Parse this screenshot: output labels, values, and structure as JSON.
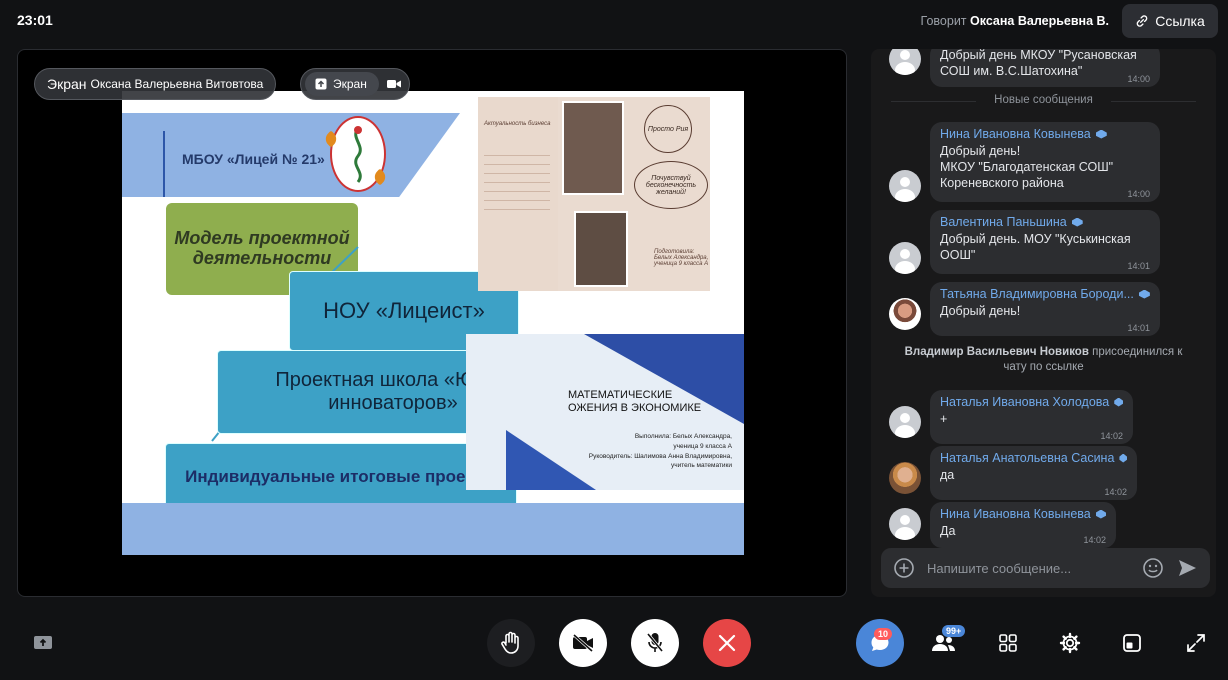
{
  "topbar": {
    "clock": "23:01",
    "speaking_prefix": "Говорит",
    "speaking_name": "Оксана Валерьевна В.",
    "link_label": "Ссылка"
  },
  "stage": {
    "pill_prefix": "Экран",
    "pill_name": "Оксана Валерьевна Витовтова",
    "screen_chip": "Экран"
  },
  "slide": {
    "school": "МБОУ «Лицей № 21»",
    "green_title": "Модель проектной деятельности",
    "box1": "НОУ «Лицеист»",
    "box2": "Проектная школа «Юных инноваторов»",
    "box3": "Индивидуальные итоговые проекты",
    "poster": {
      "header": "Актуальность бизнеса",
      "logo": "Просто Рия",
      "oval": "Почувствуй бесконечность желаний!",
      "author": "Подготовила: Белых Александра, ученица 9 класса А"
    },
    "cover": {
      "title_line1": "МАТЕМАТИЧЕСКИЕ",
      "title_line2": "ОЖЕНИЯ В ЭКОНОМИКЕ",
      "author_line1": "Выполнила: Белых Александра,",
      "author_line2": "ученица 9 класса А",
      "author_line3": "Руководитель: Шалимова Анна Владимировна,",
      "author_line4": "учитель математики"
    }
  },
  "chat": {
    "divider": "Новые сообщения",
    "system_name": "Владимир Васильевич Новиков",
    "system_text": " присоединился к чату по ссылке",
    "input_placeholder": "Напишите сообщение...",
    "messages": [
      {
        "name": "",
        "text": "Добрый день МКОУ \"Русановская\nСОШ им. В.С.Шатохина\"",
        "time": "14:00"
      },
      {
        "name": "Нина Ивановна Ковынева",
        "text": "Добрый день!\nМКОУ \"Благодатенская СОШ\"\nКореневского района",
        "time": "14:00"
      },
      {
        "name": "Валентина Паньшина",
        "text": "Добрый день. МОУ \"Куськинская\nООШ\"",
        "time": "14:01"
      },
      {
        "name": "Татьяна Владимировна Бороди...",
        "text": "Добрый день!",
        "time": "14:01"
      },
      {
        "name": "Наталья Ивановна Холодова",
        "text": "+",
        "time": "14:02"
      },
      {
        "name": "Наталья Анатольевна Сасина",
        "text": "да",
        "time": "14:02"
      },
      {
        "name": "Нина Ивановна Ковынева",
        "text": "Да",
        "time": "14:02"
      }
    ]
  },
  "bottombar": {
    "chat_badge": "10",
    "participants_badge": "99+"
  }
}
